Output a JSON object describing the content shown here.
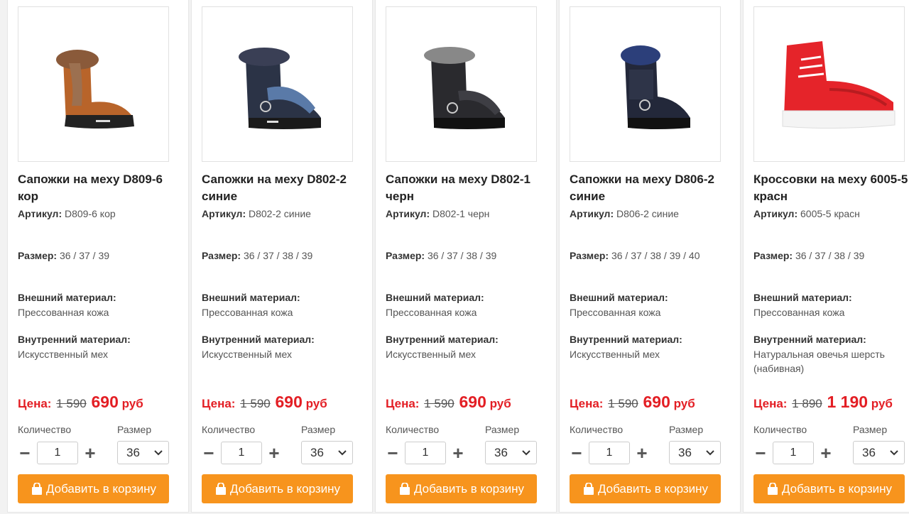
{
  "labels": {
    "article": "Артикул:",
    "size": "Размер:",
    "outer": "Внешний материал:",
    "inner": "Внутренний материал:",
    "price": "Цена:",
    "qty": "Количество",
    "size_select": "Размер",
    "add_to_cart": "Добавить в корзину"
  },
  "colors": {
    "accent": "#f7941d",
    "price_red": "#e31e24"
  },
  "products": [
    {
      "title": "Сапожки на меху D809-6 кор",
      "article": "D809-6 кор",
      "sizes": "36 / 37 / 39",
      "outer": "Прессованная кожа",
      "inner": "Искусственный мех",
      "old_price": "1 590",
      "new_price": "690",
      "currency": "руб",
      "qty": "1",
      "selected_size": "36",
      "image": "brown-fur-boot"
    },
    {
      "title": "Сапожки на меху D802-2 синие",
      "article": "D802-2 синие",
      "sizes": "36 / 37 / 38 / 39",
      "outer": "Прессованная кожа",
      "inner": "Искусственный мех",
      "old_price": "1 590",
      "new_price": "690",
      "currency": "руб",
      "qty": "1",
      "selected_size": "36",
      "image": "navy-fur-boot"
    },
    {
      "title": "Сапожки на меху D802-1 черн",
      "article": "D802-1 черн",
      "sizes": "36 / 37 / 38 / 39",
      "outer": "Прессованная кожа",
      "inner": "Искусственный мех",
      "old_price": "1 590",
      "new_price": "690",
      "currency": "руб",
      "qty": "1",
      "selected_size": "36",
      "image": "black-fur-boot"
    },
    {
      "title": "Сапожки на меху D806-2 синие",
      "article": "D806-2 синие",
      "sizes": "36 / 37 / 38 / 39 / 40",
      "outer": "Прессованная кожа",
      "inner": "Искусственный мех",
      "old_price": "1 590",
      "new_price": "690",
      "currency": "руб",
      "qty": "1",
      "selected_size": "36",
      "image": "dark-blue-fur-boot"
    },
    {
      "title": "Кроссовки на меху 6005-5 красн",
      "article": "6005-5 красн",
      "sizes": "36 / 37 / 38 / 39",
      "outer": "Прессованная кожа",
      "inner": "Натуральная овечья шерсть (набивная)",
      "old_price": "1 890",
      "new_price": "1 190",
      "currency": "руб",
      "qty": "1",
      "selected_size": "36",
      "image": "red-sneaker"
    }
  ]
}
